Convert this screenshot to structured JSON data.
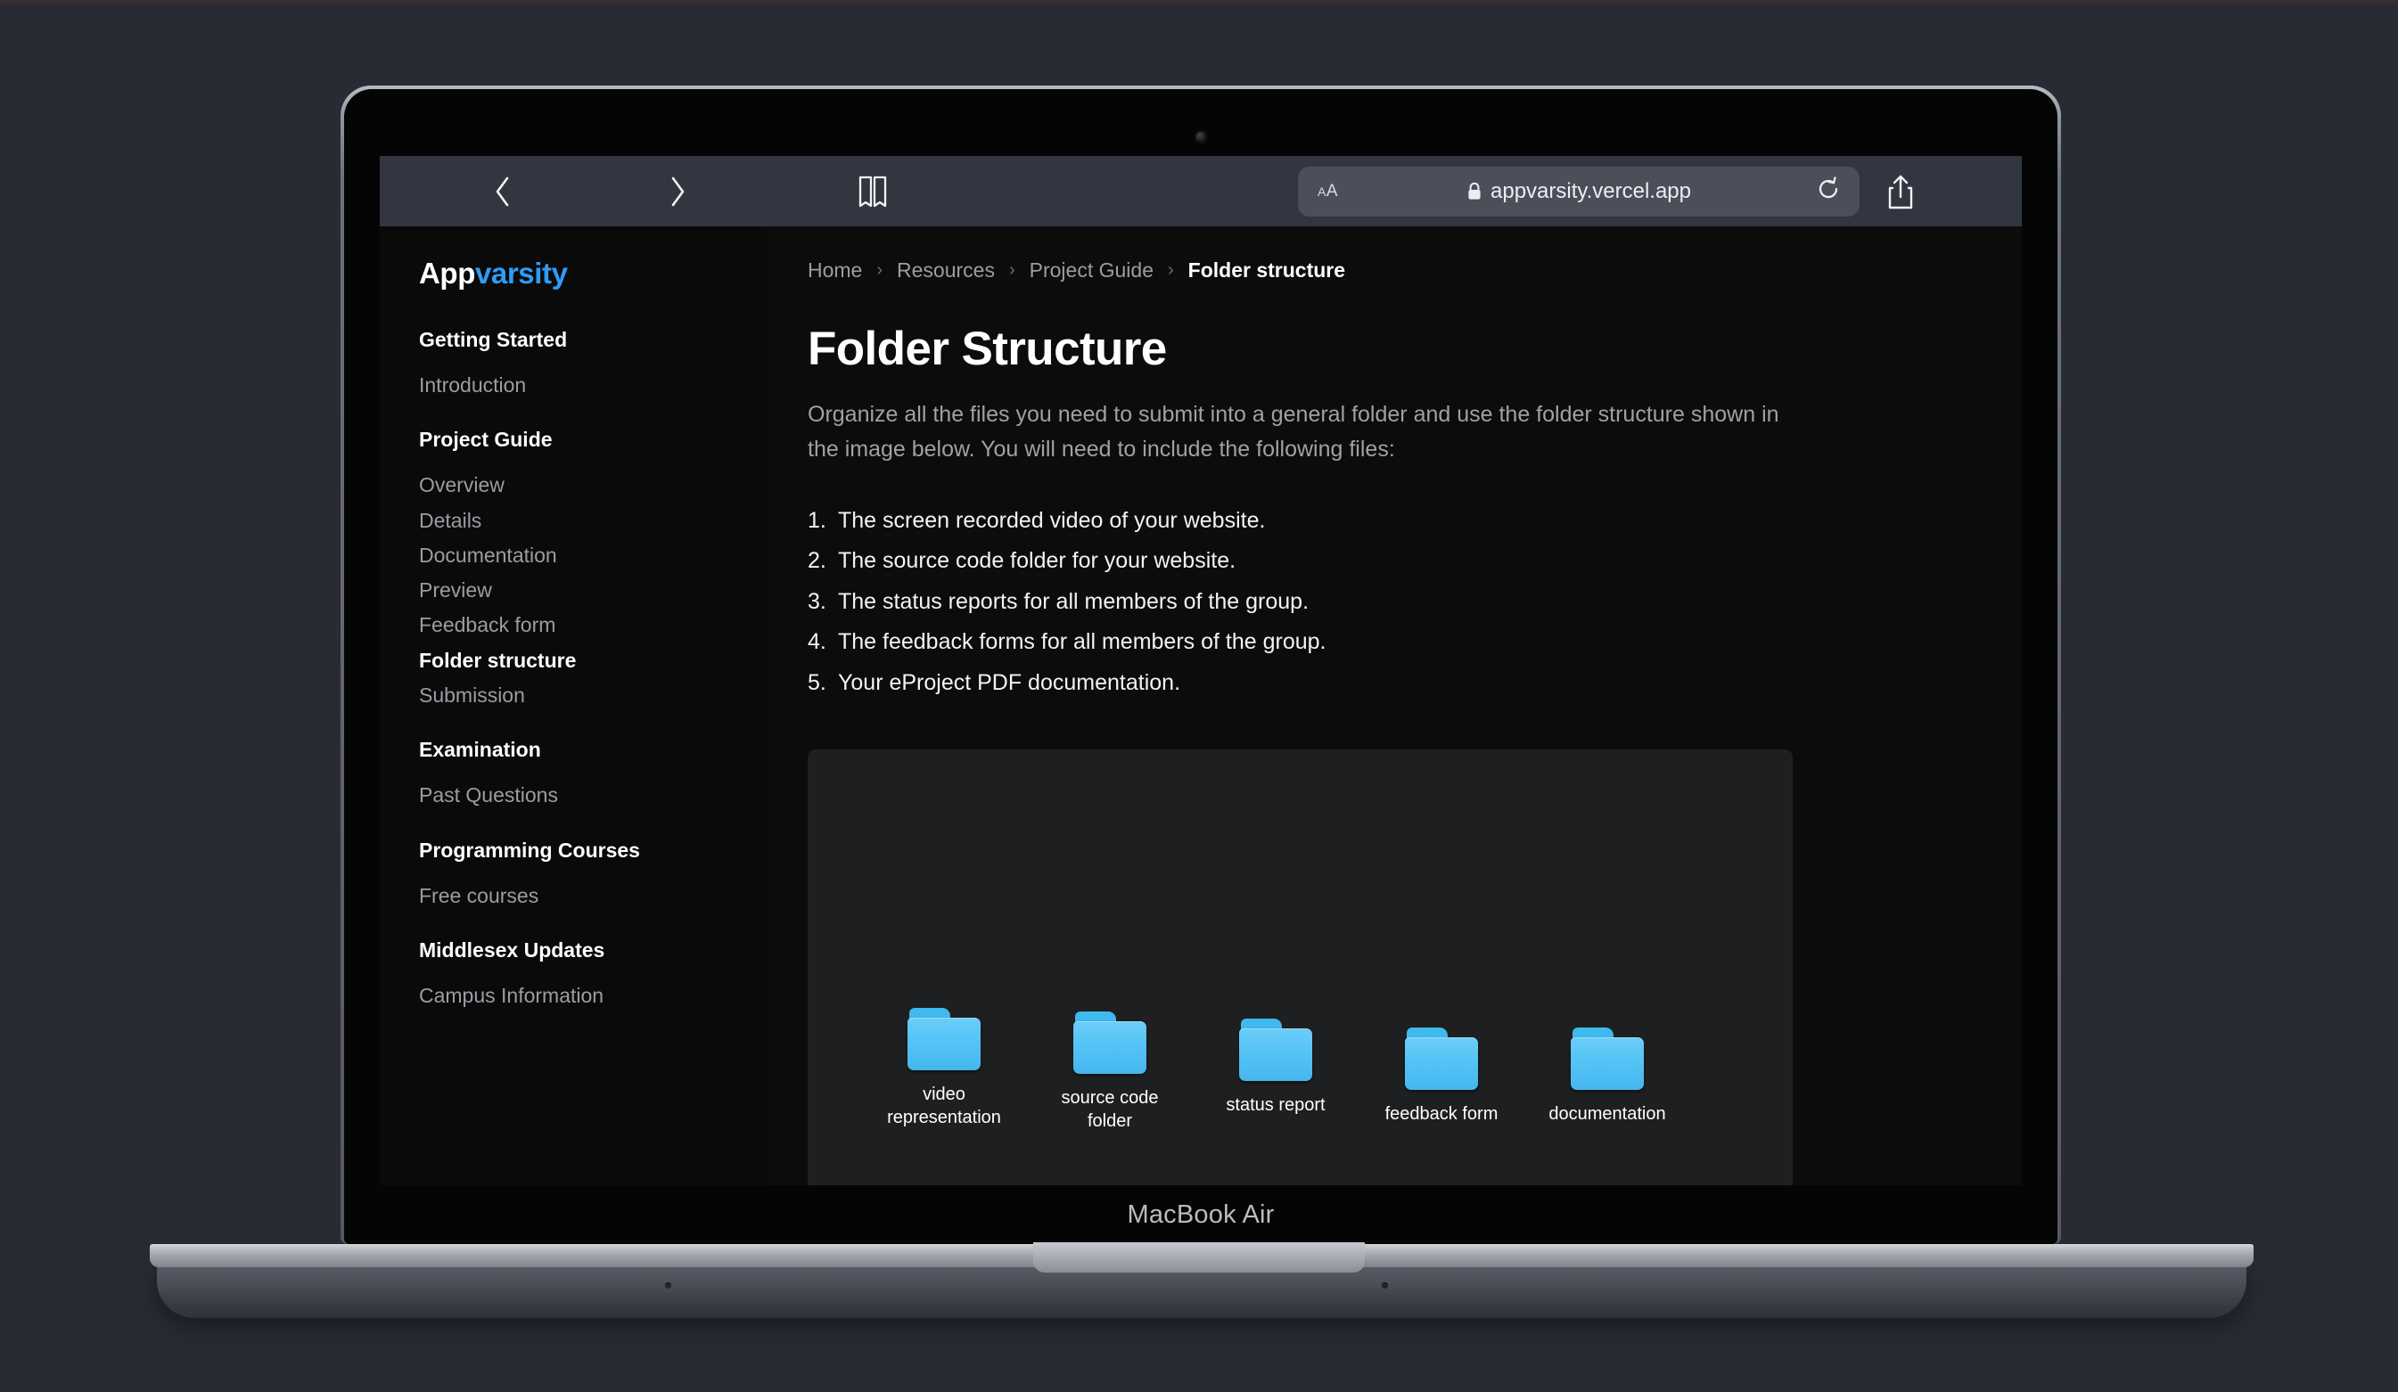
{
  "device": {
    "model_label": "MacBook Air"
  },
  "browser": {
    "icons": {
      "back": "back-chevron-icon",
      "forward": "forward-chevron-icon",
      "bookmarks": "book-icon",
      "lock": "lock-icon",
      "reload": "reload-icon",
      "share": "share-icon",
      "new_tab": "plus-icon",
      "tabs": "tabs-icon"
    },
    "address_bar": {
      "text_size_label": "AA",
      "url": "appvarsity.vercel.app",
      "secure": true
    }
  },
  "colors": {
    "page_background": "#282b33",
    "site_background": "#0c0c0c",
    "sidebar_background": "#0a0a0a",
    "figure_background": "#1e1f21",
    "brand_accent": "#2e9cf5",
    "folder_blue": "#56c4f6",
    "muted_text": "#9a9da3",
    "primary_text": "#ffffff"
  },
  "site": {
    "logo": {
      "part1": "App",
      "part2": "varsity"
    },
    "sidebar": [
      {
        "heading": "Getting Started",
        "items": [
          {
            "label": "Introduction",
            "active": false
          }
        ]
      },
      {
        "heading": "Project Guide",
        "items": [
          {
            "label": "Overview",
            "active": false
          },
          {
            "label": "Details",
            "active": false
          },
          {
            "label": "Documentation",
            "active": false
          },
          {
            "label": "Preview",
            "active": false
          },
          {
            "label": "Feedback form",
            "active": false
          },
          {
            "label": "Folder structure",
            "active": true
          },
          {
            "label": "Submission",
            "active": false
          }
        ]
      },
      {
        "heading": "Examination",
        "items": [
          {
            "label": "Past Questions",
            "active": false
          }
        ]
      },
      {
        "heading": "Programming Courses",
        "items": [
          {
            "label": "Free courses",
            "active": false
          }
        ]
      },
      {
        "heading": "Middlesex Updates",
        "items": [
          {
            "label": "Campus Information",
            "active": false
          }
        ]
      }
    ],
    "breadcrumb": [
      {
        "label": "Home",
        "current": false
      },
      {
        "label": "Resources",
        "current": false
      },
      {
        "label": "Project Guide",
        "current": false
      },
      {
        "label": "Folder structure",
        "current": true
      }
    ],
    "breadcrumb_separator": "›",
    "main": {
      "title": "Folder Structure",
      "lede": "Organize all the files you need to submit into a general folder and use the folder structure shown in the image below. You will need to include the following files:",
      "steps": [
        {
          "n": "1.",
          "text": "The screen recorded video of your website."
        },
        {
          "n": "2.",
          "text": "The source code folder for your website."
        },
        {
          "n": "3.",
          "text": "The status reports for all members of the group."
        },
        {
          "n": "4.",
          "text": "The feedback forms for all members of the group."
        },
        {
          "n": "5.",
          "text": "Your eProject PDF documentation."
        }
      ],
      "figure": {
        "folders": [
          {
            "label": "video\nrepresentation"
          },
          {
            "label": "source code\nfolder"
          },
          {
            "label": "status report"
          },
          {
            "label": "feedback form"
          },
          {
            "label": "documentation"
          }
        ]
      }
    }
  }
}
